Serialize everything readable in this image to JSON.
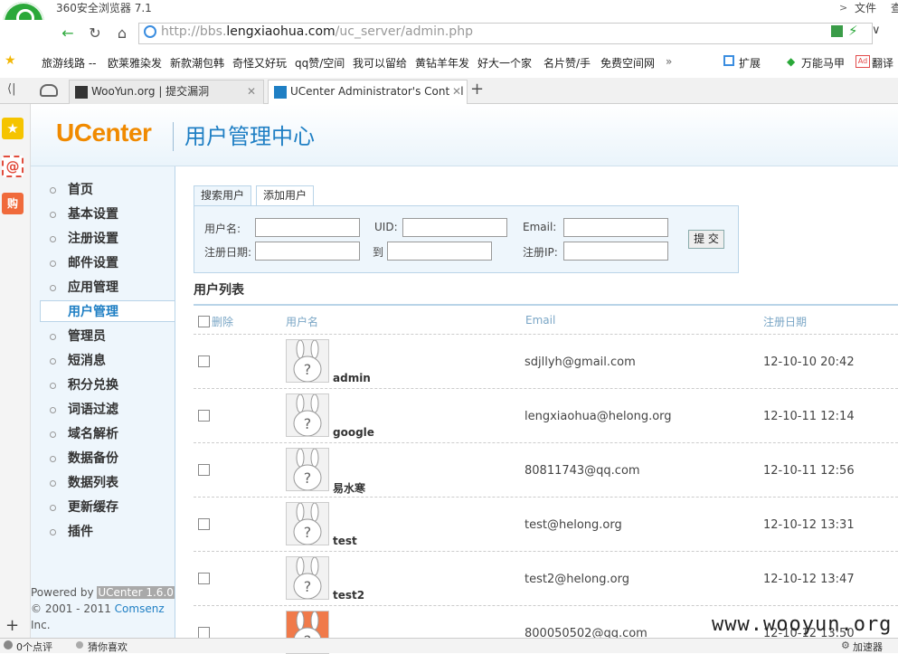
{
  "browser": {
    "title": "360安全浏览器 7.1",
    "menu": [
      "文件",
      "查"
    ],
    "url_prefix": "http://bbs.",
    "url_domain": "lengxiaohua.com",
    "url_path": "/uc_server/admin.php",
    "bookmarks": [
      "旅游线路 --",
      "欧莱雅染发",
      "新款潮包韩",
      "奇怪又好玩",
      "qq赞/空间",
      "我可以留给",
      "黄钻羊年发",
      "好大一个家",
      "名片赞/手",
      "免费空间网",
      "扩展",
      "万能马甲",
      "翻译"
    ],
    "tabs": [
      "WooYun.org | 提交漏洞",
      "UCenter Administrator's Control"
    ]
  },
  "header": {
    "brand": "UCenter",
    "subtitle": "用户管理中心"
  },
  "sidebar": {
    "items": [
      "首页",
      "基本设置",
      "注册设置",
      "邮件设置",
      "应用管理",
      "用户管理",
      "管理员",
      "短消息",
      "积分兑换",
      "词语过滤",
      "域名解析",
      "数据备份",
      "数据列表",
      "更新缓存",
      "插件"
    ],
    "active_index": 5,
    "powered_prefix": "Powered by ",
    "powered_version": "UCenter 1.6.0",
    "copyright_prefix": "© 2001 - 2011 ",
    "copyright_company": "Comsenz",
    "copyright_suffix": "Inc."
  },
  "search": {
    "tabs": [
      "搜索用户",
      "添加用户"
    ],
    "username_label": "用户名:",
    "uid_label": "UID:",
    "email_label": "Email:",
    "regdate_label": "注册日期:",
    "to_label": "到",
    "regip_label": "注册IP:",
    "submit_label": "提 交"
  },
  "list": {
    "title": "用户列表",
    "headers": {
      "delete": "删除",
      "username": "用户名",
      "email": "Email",
      "regdate": "注册日期"
    },
    "rows": [
      {
        "username": "admin",
        "email": "sdjllyh@gmail.com",
        "regdate": "12-10-10 20:42"
      },
      {
        "username": "google",
        "email": "lengxiaohua@helong.org",
        "regdate": "12-10-11 12:14"
      },
      {
        "username": "易水寒",
        "email": "80811743@qq.com",
        "regdate": "12-10-11 12:56"
      },
      {
        "username": "test",
        "email": "test@helong.org",
        "regdate": "12-10-12 13:31"
      },
      {
        "username": "test2",
        "email": "test2@helong.org",
        "regdate": "12-10-12 13:47"
      },
      {
        "username": "",
        "email": "800050502@qq.com",
        "regdate": "12-10-12 13:50"
      }
    ]
  },
  "watermark": "www.wooyun.org",
  "status": {
    "left": "0个点评",
    "middle": "猜你喜欢",
    "right": "加速器"
  }
}
